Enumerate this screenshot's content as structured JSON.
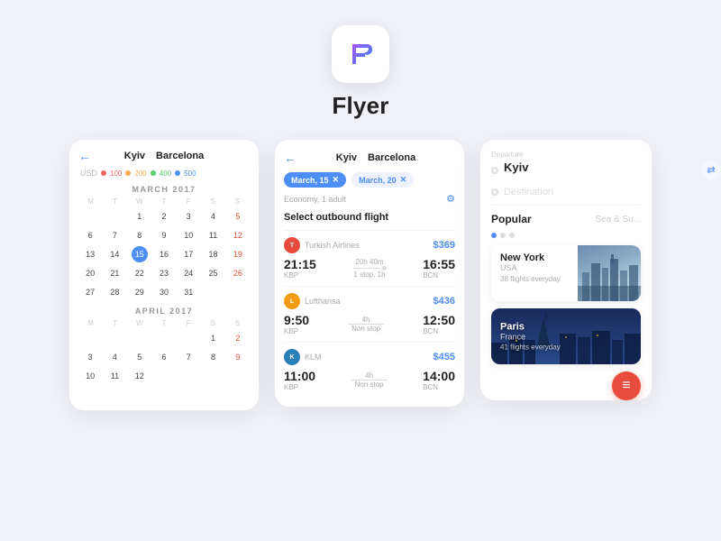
{
  "app": {
    "title": "Flyer",
    "icon_letter": "F"
  },
  "card1": {
    "arrow": "←",
    "from": "Kyiv",
    "to": "Barcelona",
    "currency": "USD",
    "weekdays": [
      "M",
      "T",
      "W",
      "T",
      "F",
      "S",
      "S"
    ],
    "month1": "MARCH 2017",
    "month2": "APRIL 2017",
    "march_empty_start": 2,
    "march_days": 31,
    "april_days": 12
  },
  "card2": {
    "arrow": "←",
    "from": "Kyiv",
    "to": "Barcelona",
    "date1": "March, 15",
    "date2": "March, 20",
    "economy": "Economy, 1 adult",
    "select_title": "Select outbound flight",
    "flights": [
      {
        "airline": "Turkish Airlines",
        "price": "$369",
        "depart": "21:15",
        "arrive": "16:55",
        "duration": "20h 40m",
        "stops": "1 stop, 1h",
        "dep_code": "KBP",
        "arr_code": "BCN",
        "logo_class": "logo-turkish"
      },
      {
        "airline": "Lufthansa",
        "price": "$436",
        "depart": "9:50",
        "arrive": "12:50",
        "duration": "4h",
        "stops": "Non stop",
        "dep_code": "KBP",
        "arr_code": "BCN",
        "logo_class": "logo-lufthansa"
      },
      {
        "airline": "KLM",
        "price": "$455",
        "depart": "11:00",
        "arrive": "14:00",
        "duration": "4h",
        "stops": "Non stop",
        "dep_code": "KBP",
        "arr_code": "BCN",
        "logo_class": "logo-klm"
      }
    ]
  },
  "card3": {
    "departure_label": "Departure",
    "departure_city": "Kyiv",
    "destination_placeholder": "Destination",
    "popular_title": "Popular",
    "popular_sub": "Sea & Su...",
    "destinations": [
      {
        "city": "New York",
        "country": "USA",
        "flights": "38 flights everyday"
      },
      {
        "city": "Paris",
        "country": "France",
        "flights": "41 flights everyday"
      }
    ]
  }
}
